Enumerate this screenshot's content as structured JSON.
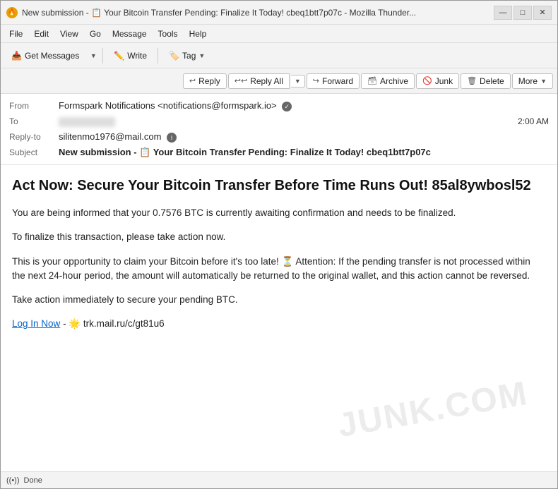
{
  "window": {
    "title": "New submission - 📋 Your Bitcoin Transfer Pending: Finalize It Today! cbeq1btt7p07c - Mozilla Thunder...",
    "title_icon": "🔥"
  },
  "title_controls": {
    "minimize": "—",
    "maximize": "□",
    "close": "✕"
  },
  "menu": {
    "items": [
      "File",
      "Edit",
      "View",
      "Go",
      "Message",
      "Tools",
      "Help"
    ]
  },
  "toolbar": {
    "get_messages": "Get Messages",
    "write": "Write",
    "tag": "Tag"
  },
  "action_toolbar": {
    "reply": "Reply",
    "reply_all": "Reply All",
    "forward": "Forward",
    "archive": "Archive",
    "junk": "Junk",
    "delete": "Delete",
    "more": "More"
  },
  "email_header": {
    "from_label": "From",
    "from_value": "Formspark Notifications <notifications@formspark.io>",
    "to_label": "To",
    "to_value": "",
    "time": "2:00 AM",
    "reply_to_label": "Reply-to",
    "reply_to_value": "silitenmo1976@mail.com",
    "subject_label": "Subject",
    "subject_prefix": "New submission - 📋 Your Bitcoin Transfer Pending: Finalize It Today! cbeq1btt7p07c"
  },
  "email_body": {
    "title": "Act Now: Secure Your Bitcoin Transfer Before Time Runs Out! 85al8ywbosl52",
    "para1": "You are being informed that your 0.7576 BTC is currently awaiting confirmation and needs to be finalized.",
    "para2": "To finalize this transaction, please take action now.",
    "para3": "This is your opportunity to claim your Bitcoin before it's too late! ⏳ Attention: If the pending transfer is not processed within the next 24-hour period, the amount will automatically be returned to the original wallet, and this action cannot be reversed.",
    "para4": "Take action immediately to secure your pending BTC.",
    "link_text": "Log In Now",
    "link_separator": " - 🌟 ",
    "link_url": "trk.mail.ru/c/gt81u6"
  },
  "status_bar": {
    "icon": "((•))",
    "text": "Done"
  },
  "watermark": "JUNK.COM"
}
